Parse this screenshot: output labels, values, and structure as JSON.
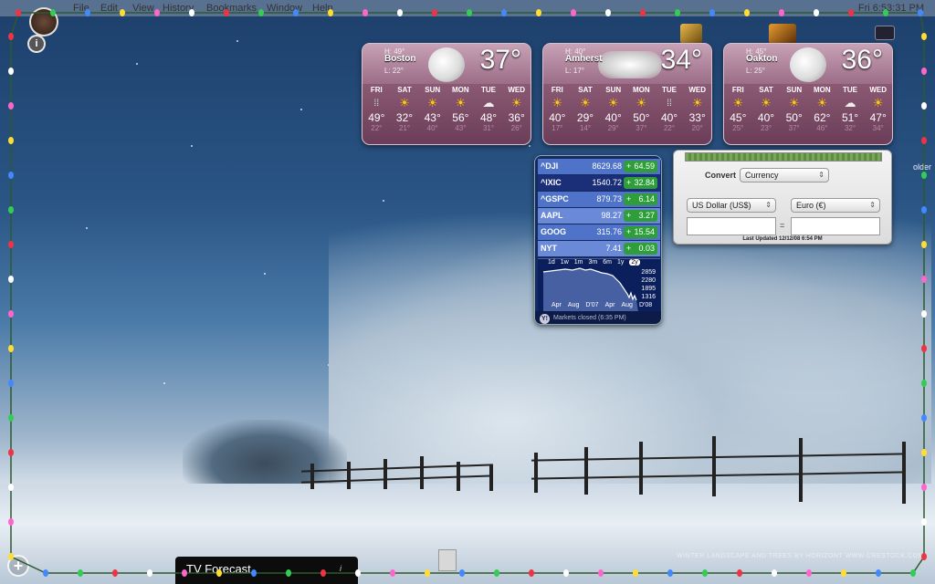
{
  "menubar": {
    "items": [
      "File",
      "Edit",
      "View",
      "History",
      "Bookmarks",
      "Window",
      "Help"
    ],
    "clock": "Fri 6:53:31 PM"
  },
  "dashboard": {
    "info_button": "i",
    "add_button": "+"
  },
  "weather": [
    {
      "city": "Boston",
      "hi": "H: 49°",
      "lo": "L: 22°",
      "temp": "37°",
      "icon": "moon",
      "days": [
        {
          "name": "FRI",
          "icon": "rain",
          "hi": "49°",
          "lo": "22°"
        },
        {
          "name": "SAT",
          "icon": "sun",
          "hi": "32°",
          "lo": "21°"
        },
        {
          "name": "SUN",
          "icon": "sun",
          "hi": "43°",
          "lo": "40°"
        },
        {
          "name": "MON",
          "icon": "sun",
          "hi": "56°",
          "lo": "43°"
        },
        {
          "name": "TUE",
          "icon": "cloud",
          "hi": "48°",
          "lo": "31°"
        },
        {
          "name": "WED",
          "icon": "sun",
          "hi": "36°",
          "lo": "26°"
        }
      ]
    },
    {
      "city": "Amherst",
      "hi": "H: 40°",
      "lo": "L: 17°",
      "temp": "34°",
      "icon": "cloud",
      "days": [
        {
          "name": "FRI",
          "icon": "sun",
          "hi": "40°",
          "lo": "17°"
        },
        {
          "name": "SAT",
          "icon": "sun",
          "hi": "29°",
          "lo": "14°"
        },
        {
          "name": "SUN",
          "icon": "sun",
          "hi": "40°",
          "lo": "29°"
        },
        {
          "name": "MON",
          "icon": "sun",
          "hi": "50°",
          "lo": "37°"
        },
        {
          "name": "TUE",
          "icon": "rain",
          "hi": "40°",
          "lo": "22°"
        },
        {
          "name": "WED",
          "icon": "sun",
          "hi": "33°",
          "lo": "20°"
        }
      ]
    },
    {
      "city": "Oakton",
      "hi": "H: 45°",
      "lo": "L: 25°",
      "temp": "36°",
      "icon": "moon",
      "days": [
        {
          "name": "FRI",
          "icon": "sun",
          "hi": "45°",
          "lo": "25°"
        },
        {
          "name": "SAT",
          "icon": "sun",
          "hi": "40°",
          "lo": "23°"
        },
        {
          "name": "SUN",
          "icon": "sun",
          "hi": "50°",
          "lo": "37°"
        },
        {
          "name": "MON",
          "icon": "sun",
          "hi": "62°",
          "lo": "46°"
        },
        {
          "name": "TUE",
          "icon": "cloud",
          "hi": "51°",
          "lo": "32°"
        },
        {
          "name": "WED",
          "icon": "sun",
          "hi": "47°",
          "lo": "34°"
        }
      ]
    }
  ],
  "stocks": {
    "rows": [
      {
        "symbol": "^DJI",
        "price": "8629.68",
        "change": "64.59"
      },
      {
        "symbol": "^IXIC",
        "price": "1540.72",
        "change": "32.84"
      },
      {
        "symbol": "^GSPC",
        "price": "879.73",
        "change": "6.14"
      },
      {
        "symbol": "AAPL",
        "price": "98.27",
        "change": "3.27"
      },
      {
        "symbol": "GOOG",
        "price": "315.76",
        "change": "15.54"
      },
      {
        "symbol": "NYT",
        "price": "7.41",
        "change": "0.03"
      }
    ],
    "ranges": [
      "1d",
      "1w",
      "1m",
      "3m",
      "6m",
      "1y",
      "2y"
    ],
    "selected_range": "2y",
    "y_values": [
      "2859",
      "2280",
      "1895",
      "1316"
    ],
    "x_values": [
      "Apr",
      "Aug",
      "D'07",
      "Apr",
      "Aug",
      "D'08"
    ],
    "footer": "Markets closed (6:35 PM)",
    "yahoo": "Y!"
  },
  "converter": {
    "convert_label": "Convert",
    "category": "Currency",
    "from": "US Dollar (US$)",
    "to": "Euro (€)",
    "equals": "=",
    "from_value": "",
    "to_value": "",
    "updated": "Last Updated 12/12/08 6:54 PM"
  },
  "tv": {
    "title": "TV Forecast",
    "info": "i"
  },
  "credit": "WINTER LANDSCAPE AND TREES BY HORIZONT    WWW.CRESTOCK.COM",
  "side_text": {
    "folder": "older"
  }
}
